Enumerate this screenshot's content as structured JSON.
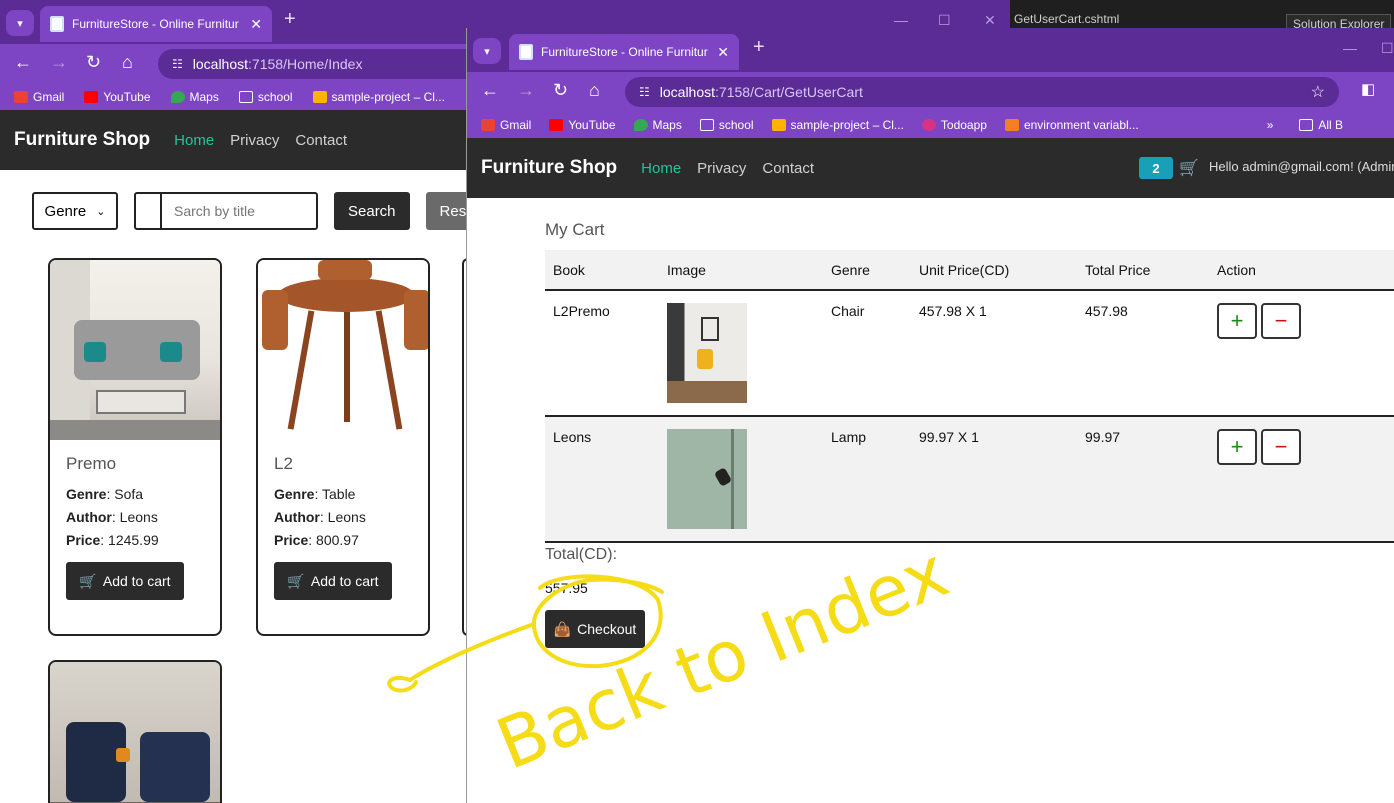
{
  "ide": {
    "tab": "GetUserCart.cshtml",
    "solution": "Solution Explorer"
  },
  "left_window": {
    "tab_title": "FurnitureStore - Online Furnitur",
    "url_host": "localhost",
    "url_path": ":7158/Home/Index",
    "bookmarks": [
      "Gmail",
      "YouTube",
      "Maps",
      "school",
      "sample-project – Cl..."
    ],
    "brand": "Furniture Shop",
    "nav": [
      "Home",
      "Privacy",
      "Contact"
    ],
    "filters": {
      "genre_label": "Genre",
      "search_placeholder": "Sarch by title",
      "search_button": "Search",
      "reset_button": "Reset"
    },
    "products": [
      {
        "title": "Premo",
        "genre_label": "Genre",
        "genre": "Sofa",
        "author_label": "Author",
        "author": "Leons",
        "price_label": "Price",
        "price": "1245.99",
        "cart_label": "Add to cart"
      },
      {
        "title": "L2",
        "genre_label": "Genre",
        "genre": "Table",
        "author_label": "Author",
        "author": "Leons",
        "price_label": "Price",
        "price": "800.97",
        "cart_label": "Add to cart"
      }
    ]
  },
  "right_window": {
    "tab_title": "FurnitureStore - Online Furnitur",
    "url_host": "localhost",
    "url_path": ":7158/Cart/GetUserCart",
    "bookmarks": [
      "Gmail",
      "YouTube",
      "Maps",
      "school",
      "sample-project – Cl...",
      "Todoapp",
      "environment variabl...",
      "All B"
    ],
    "brand": "Furniture Shop",
    "nav": [
      "Home",
      "Privacy",
      "Contact"
    ],
    "cart_count": "2",
    "greeting": "Hello admin@gmail.com! (Admin)",
    "cart": {
      "heading": "My Cart",
      "columns": [
        "Book",
        "Image",
        "Genre",
        "Unit Price(CD)",
        "Total Price",
        "Action"
      ],
      "rows": [
        {
          "book": "L2Premo",
          "genre": "Chair",
          "unit": "457.98 X 1",
          "total": "457.98"
        },
        {
          "book": "Leons",
          "genre": "Lamp",
          "unit": "99.97 X 1",
          "total": "99.97"
        }
      ],
      "plus": "+",
      "minus": "−",
      "total_label": "Total(CD):",
      "total_value": "557.95",
      "checkout": "Checkout"
    }
  },
  "annotation": {
    "text": "Back to Index",
    "color": "#f5dc16"
  }
}
